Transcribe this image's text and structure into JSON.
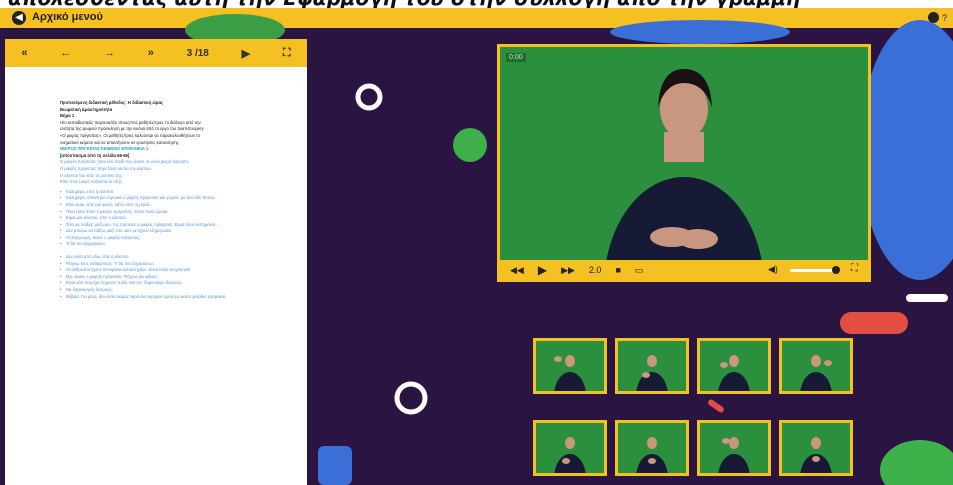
{
  "header": {
    "title_fragment": "απολεσθέντας αυτή την Εφαρμογή του στην συλλογή από την γραμμή",
    "menu_label": "Αρχικό μενού",
    "help_label": "?"
  },
  "doc_toolbar": {
    "first": "«",
    "prev": "←",
    "next": "→",
    "last": "»",
    "page_indicator": "3 /18",
    "play": "▶",
    "fullscreen": "⛶"
  },
  "document": {
    "line1": "Προτεινόμενη διδακτική μέθοδος: Η διδακτική ώρας",
    "line2": "Βιωματική Δραστηριότητα",
    "line3": "Βήμα 1",
    "line4": "Η/ο εκπαιδευτικός παρουσιάζει στους/στις μαθητές/τριες το διάλογο από την",
    "line5": "ενότητα της ψωμιού πρόσκληση με την εικόνα από το έργο του Saint-Exupery",
    "line6": "«Ο μικρός πρίγκιπας». Οι μαθητές/τριες καλούνται να παρακολουθήσουν το",
    "line7": "νοηματικό κείμενο και να απαντήσουν σε ερωτήσεις κατανόησης.",
    "section_title": "ΜΙΚΡΟΣ ΠΡΙΓΚΙΠΑΣ ΚΕΙΜΕΝΟ ΕΠΙΦΑΝΕΙΑ 1",
    "subtitle": "[απόσπασμα από τη σελίδα 68-69]",
    "blue1": "Ο μικρός πρίγκιπας ήταν ένα παιδί που ζούσε σε έναν μικρό πλανήτη.",
    "blue2": "Ο μικρός πρίγκιπας πήγε ξανά να δει την αλεπού.",
    "blue3": "Η αλεπού του είπε το μυστικό της.",
    "blue4": "Είπε στον μικρό πρίγκιπα τα εξής:",
    "items": [
      "Καλημέρα, είπε η αλεπού.",
      "Καλημέρα, απάντησε ευγενικά ο μικρός πρίγκιπας και γύρισε, μα δεν είδε τίποτα.",
      "Εδώ είμαι, είπε μια φωνή, κάτω από τη μηλιά...",
      "Ποια είσαι; Είπε ο μικρός πρίγκιπας. Είσαι πολύ ωραία.",
      "Είμαι μια αλεπού, είπε η αλεπού.",
      "Έλα να παίξεις μαζί μου, της πρότεινε ο μικρός πρίγκιπας. Είμαι τόσο λυπημένος...",
      "Δεν μπορώ να παίξω μαζί σου. Δεν με έχουν εξημερώσει.",
      "Α! Συγγνώμη, έκανε ο μικρός πρίγκιπας.",
      "Τι θα πει εξημερώνω;"
    ],
    "items2": [
      "Δεν είσαι από εδώ, είπε η αλεπού.",
      "Ψάχνω τους ανθρώπους. Τι θα πει εξημερώνω;",
      "Οι άνθρωποι έχουν ντουφέκια και κυνηγάνε. Είναι πολύ ενοχλητικό!",
      "Όχι, έκανε ο μικρός πρίγκιπας. Ψάχνω για φίλους.",
      "Είναι κάτι που έχει ξεχαστεί πολύ. Θα πει: δημιουργώ δεσμούς.",
      "Να δημιουργείς δεσμούς;",
      "Βέβαια. Για μένα, δεν είσαι ακόμα παρά ένα αγοράκι όμοιο με εκατό χιλιάδες αγοράκια."
    ]
  },
  "video": {
    "timestamp": "0:00",
    "speed": "2.0"
  },
  "colors": {
    "accent": "#f5c021",
    "background": "#2a1442",
    "video_green": "#2b8f3e"
  }
}
